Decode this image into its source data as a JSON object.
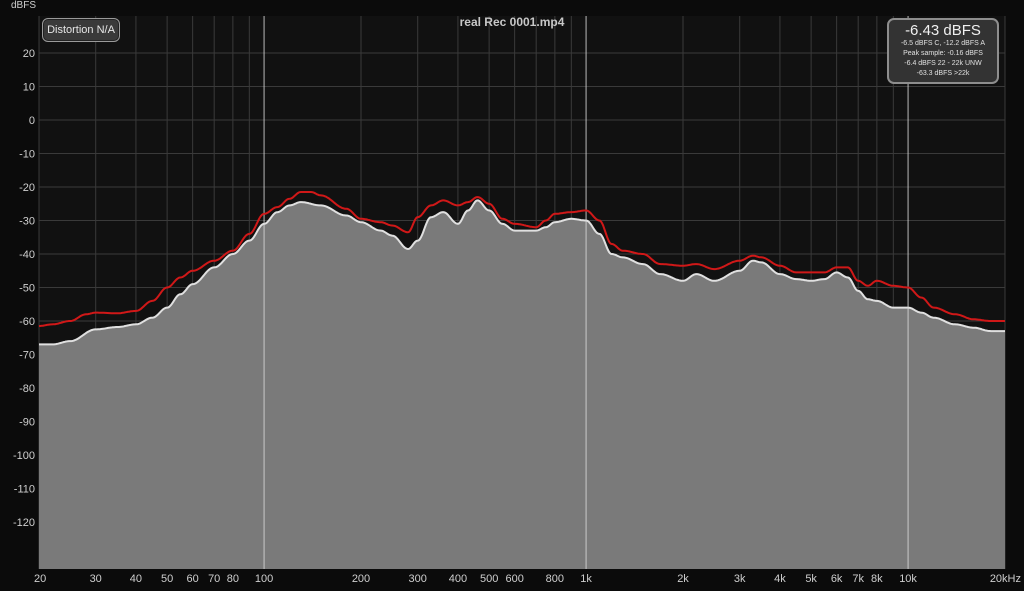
{
  "title": "real Rec 0001.mp4",
  "distortion_button": "Distortion N/A",
  "readout": {
    "main": "-6.43 dBFS",
    "lines": [
      "-6.5 dBFS C, -12.2 dBFS A",
      "Peak sample: -0.16 dBFS",
      "-6.4 dBFS 22 - 22k UNW",
      "-63.3 dBFS >22k"
    ]
  },
  "colors": {
    "background": "#111111",
    "grid": "#3a3a3a",
    "decade_line": "#d8d8d8",
    "fill": "#7a7a7a",
    "fill_edge": "#e0e0e0",
    "peak_line": "#d01818"
  },
  "chart_data": {
    "type": "area",
    "title": "real Rec 0001.mp4",
    "ylabel": "dBFS",
    "xlabel": "",
    "x_scale": "log",
    "xlim": [
      20,
      20000
    ],
    "ylim": [
      -130,
      30
    ],
    "grid": true,
    "y_ticks": [
      20,
      10,
      0,
      -10,
      -20,
      -30,
      -40,
      -50,
      -60,
      -70,
      -80,
      -90,
      -100,
      -110,
      -120
    ],
    "x_ticks": [
      {
        "v": 20,
        "label": "20"
      },
      {
        "v": 30,
        "label": "30"
      },
      {
        "v": 40,
        "label": "40"
      },
      {
        "v": 50,
        "label": "50"
      },
      {
        "v": 60,
        "label": "60"
      },
      {
        "v": 70,
        "label": "70"
      },
      {
        "v": 80,
        "label": "80"
      },
      {
        "v": 100,
        "label": "100"
      },
      {
        "v": 200,
        "label": "200"
      },
      {
        "v": 300,
        "label": "300"
      },
      {
        "v": 400,
        "label": "400"
      },
      {
        "v": 500,
        "label": "500"
      },
      {
        "v": 600,
        "label": "600"
      },
      {
        "v": 800,
        "label": "800"
      },
      {
        "v": 1000,
        "label": "1k"
      },
      {
        "v": 2000,
        "label": "2k"
      },
      {
        "v": 3000,
        "label": "3k"
      },
      {
        "v": 4000,
        "label": "4k"
      },
      {
        "v": 5000,
        "label": "5k"
      },
      {
        "v": 6000,
        "label": "6k"
      },
      {
        "v": 7000,
        "label": "7k"
      },
      {
        "v": 8000,
        "label": "8k"
      },
      {
        "v": 10000,
        "label": "10k"
      },
      {
        "v": 20000,
        "label": "20kHz"
      }
    ],
    "minor_grid": [
      90,
      700,
      900,
      9000
    ],
    "series": [
      {
        "role": "average",
        "points": [
          [
            20,
            -67
          ],
          [
            22,
            -67
          ],
          [
            25,
            -66
          ],
          [
            30,
            -62.5
          ],
          [
            35,
            -61.8
          ],
          [
            40,
            -61
          ],
          [
            45,
            -59
          ],
          [
            50,
            -56
          ],
          [
            55,
            -52
          ],
          [
            60,
            -49
          ],
          [
            70,
            -44
          ],
          [
            80,
            -40
          ],
          [
            90,
            -36
          ],
          [
            100,
            -31
          ],
          [
            110,
            -27.5
          ],
          [
            120,
            -25.5
          ],
          [
            130,
            -24.5
          ],
          [
            150,
            -25.5
          ],
          [
            180,
            -28.5
          ],
          [
            200,
            -30.5
          ],
          [
            230,
            -33
          ],
          [
            250,
            -34.5
          ],
          [
            280,
            -38.5
          ],
          [
            300,
            -36
          ],
          [
            330,
            -29
          ],
          [
            360,
            -27.5
          ],
          [
            400,
            -31
          ],
          [
            430,
            -27
          ],
          [
            460,
            -24
          ],
          [
            500,
            -27
          ],
          [
            550,
            -31
          ],
          [
            600,
            -33
          ],
          [
            700,
            -33
          ],
          [
            750,
            -32
          ],
          [
            800,
            -30.5
          ],
          [
            900,
            -29.5
          ],
          [
            1000,
            -30
          ],
          [
            1100,
            -34
          ],
          [
            1200,
            -40
          ],
          [
            1300,
            -41
          ],
          [
            1500,
            -43
          ],
          [
            1700,
            -46
          ],
          [
            2000,
            -48
          ],
          [
            2200,
            -46
          ],
          [
            2500,
            -48
          ],
          [
            3000,
            -45
          ],
          [
            3300,
            -42
          ],
          [
            3500,
            -42.5
          ],
          [
            4000,
            -46
          ],
          [
            4500,
            -47.5
          ],
          [
            5000,
            -48
          ],
          [
            5500,
            -47.5
          ],
          [
            6000,
            -45.5
          ],
          [
            6500,
            -47
          ],
          [
            7000,
            -51
          ],
          [
            7500,
            -53.5
          ],
          [
            8000,
            -54
          ],
          [
            9000,
            -56
          ],
          [
            10000,
            -56
          ],
          [
            11000,
            -57.5
          ],
          [
            12000,
            -59
          ],
          [
            14000,
            -61
          ],
          [
            16000,
            -62
          ],
          [
            18000,
            -63
          ],
          [
            20000,
            -63
          ]
        ]
      },
      {
        "role": "peak",
        "points": [
          [
            20,
            -61.5
          ],
          [
            22,
            -61
          ],
          [
            25,
            -60
          ],
          [
            28,
            -58
          ],
          [
            30,
            -57.5
          ],
          [
            35,
            -57.7
          ],
          [
            40,
            -57
          ],
          [
            45,
            -54
          ],
          [
            50,
            -50
          ],
          [
            55,
            -47
          ],
          [
            60,
            -45
          ],
          [
            70,
            -42
          ],
          [
            80,
            -39
          ],
          [
            90,
            -34
          ],
          [
            100,
            -28
          ],
          [
            110,
            -26
          ],
          [
            120,
            -23.5
          ],
          [
            130,
            -21.5
          ],
          [
            140,
            -21.5
          ],
          [
            150,
            -22.5
          ],
          [
            180,
            -26.5
          ],
          [
            200,
            -29.5
          ],
          [
            230,
            -30.5
          ],
          [
            250,
            -31.5
          ],
          [
            280,
            -33.5
          ],
          [
            300,
            -29
          ],
          [
            330,
            -25.5
          ],
          [
            360,
            -24
          ],
          [
            400,
            -25.5
          ],
          [
            430,
            -24.5
          ],
          [
            460,
            -23
          ],
          [
            500,
            -25
          ],
          [
            550,
            -29.5
          ],
          [
            600,
            -31
          ],
          [
            700,
            -32
          ],
          [
            750,
            -30
          ],
          [
            800,
            -28
          ],
          [
            900,
            -27.5
          ],
          [
            1000,
            -27
          ],
          [
            1100,
            -30
          ],
          [
            1200,
            -37
          ],
          [
            1300,
            -39
          ],
          [
            1500,
            -40
          ],
          [
            1700,
            -43
          ],
          [
            2000,
            -43.5
          ],
          [
            2200,
            -43
          ],
          [
            2500,
            -44.5
          ],
          [
            3000,
            -42
          ],
          [
            3300,
            -40.5
          ],
          [
            3500,
            -41
          ],
          [
            4000,
            -43.5
          ],
          [
            4500,
            -45.5
          ],
          [
            5000,
            -45.5
          ],
          [
            5500,
            -45.5
          ],
          [
            6000,
            -44
          ],
          [
            6500,
            -44
          ],
          [
            7000,
            -48
          ],
          [
            7500,
            -49.5
          ],
          [
            8000,
            -48
          ],
          [
            9000,
            -49.5
          ],
          [
            10000,
            -50
          ],
          [
            11000,
            -53
          ],
          [
            12000,
            -56
          ],
          [
            14000,
            -58
          ],
          [
            16000,
            -59.5
          ],
          [
            18000,
            -60
          ],
          [
            20000,
            -60
          ]
        ]
      }
    ]
  }
}
